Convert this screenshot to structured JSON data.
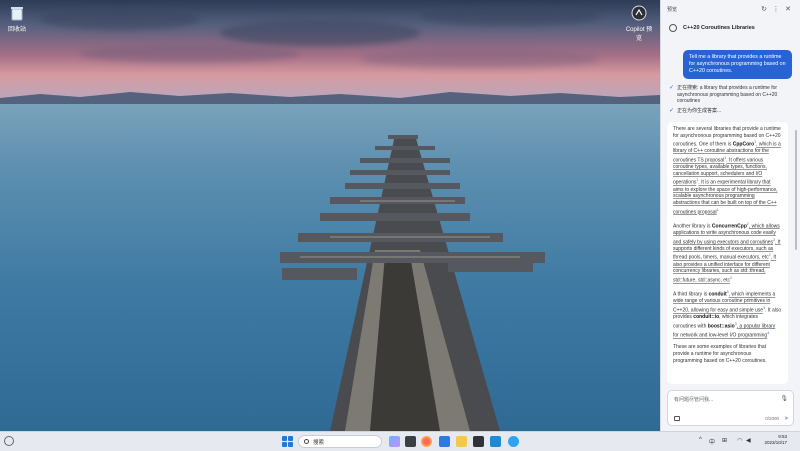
{
  "desktop": {
    "icons": [
      {
        "label": "回收站",
        "icon": "recycle-bin-icon"
      },
      {
        "label": "Copilot 预览",
        "icon": "copilot-icon"
      }
    ]
  },
  "panel": {
    "header_title": "预览",
    "header_controls": {
      "refresh": "↻",
      "more": "⋮",
      "close": "✕"
    },
    "conversation_title": "C++20 Coroutines Libraries",
    "user_message": "Tell me a library that provides a runtime for asynchronous programming based on C++20 coroutines.",
    "status": [
      "正在搜索: a library that provides a runtime for asynchronous programming based on C++20 coroutines",
      "正在为你生成答案..."
    ],
    "answer": {
      "p1": {
        "a": "There are several libraries that provide a runtime for asynchronous programming based on C++20 coroutines. One of them is ",
        "b": "CppCoro",
        "c": ", which is a library of C++ coroutine abstractions for the coroutines TS proposal",
        "d": ". It offers various coroutine types, available types, functions, cancellation support, schedulers and I/O operations",
        "e": ". It is an experimental library that aims to explore the space of high-performance, scalable asynchronous programming abstractions that can be built on top of the C++ coroutines proposal"
      },
      "p2": {
        "a": "Another library is ",
        "b": "ConcurrenCpp",
        "c": ", which allows applications to write asynchronous code easily and safely by using executors and coroutines",
        "d": ". It supports different kinds of executors, such as thread pools, timers, manual executors, etc",
        "e": ". It also provides a unified interface for different concurrency libraries, such as std::thread, std::future, std::async, etc"
      },
      "p3": {
        "a": "A third library is ",
        "b": "conduit",
        "c": ", which implements a wide range of various coroutine primitives in C++20, allowing for easy and simple use",
        "d": ". It also provides ",
        "e": "conduit::io",
        "f": ", which integrates coroutines with ",
        "g": "boost::asio",
        "h": ", a popular library for network and low-level I/O programming"
      },
      "p4": "These are some examples of libraries that provide a runtime for asynchronous programming based on C++20 coroutines."
    },
    "input_placeholder": "有问题尽管问我...",
    "char_count": "0/2000"
  },
  "taskbar": {
    "search_label": "搜索",
    "tray_icons": [
      "chevron-up-icon",
      "translate-icon",
      "grid-icon",
      "network-icon",
      "volume-icon",
      "battery-icon"
    ],
    "time": "9:53",
    "date": "2023/10/17"
  }
}
